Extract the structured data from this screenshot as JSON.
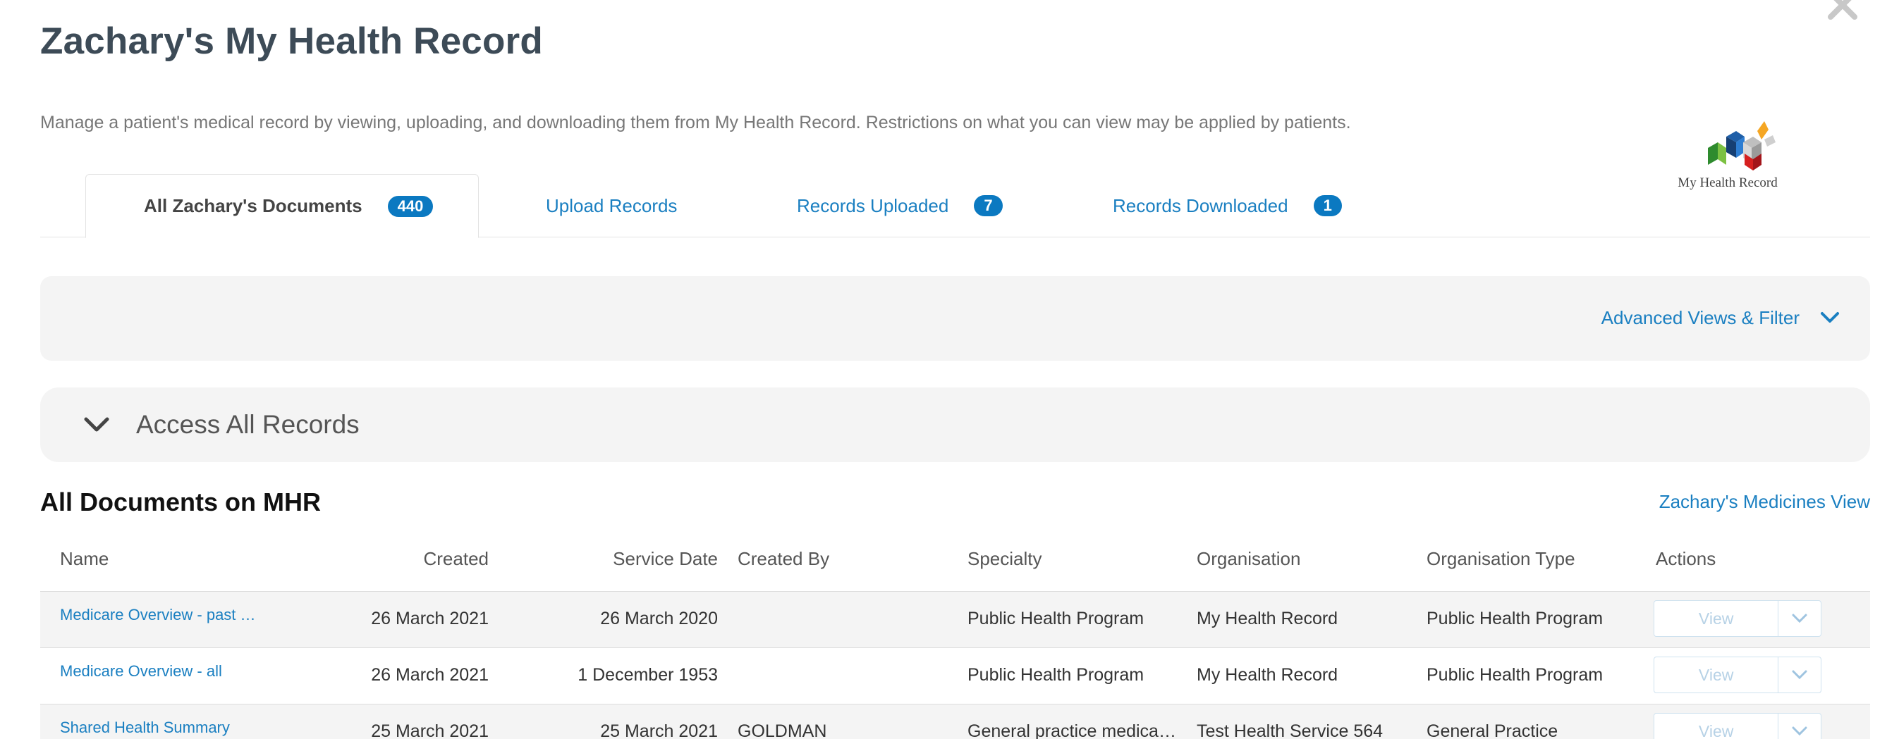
{
  "page": {
    "title": "Zachary's My Health Record",
    "description": "Manage a patient's medical record by viewing, uploading, and downloading them from My Health Record. Restrictions on what you can view may be applied by patients."
  },
  "logo": {
    "text": "My Health Record"
  },
  "tabs": [
    {
      "label": "All Zachary's Documents",
      "badge": "440",
      "active": true
    },
    {
      "label": "Upload Records",
      "badge": null,
      "active": false
    },
    {
      "label": "Records Uploaded",
      "badge": "7",
      "active": false
    },
    {
      "label": "Records Downloaded",
      "badge": "1",
      "active": false
    }
  ],
  "filter": {
    "label": "Advanced Views & Filter"
  },
  "access": {
    "label": "Access All Records"
  },
  "section": {
    "title": "All Documents on MHR",
    "medicines_link": "Zachary's Medicines View"
  },
  "table": {
    "headers": {
      "name": "Name",
      "created": "Created",
      "service_date": "Service Date",
      "created_by": "Created By",
      "specialty": "Specialty",
      "organisation": "Organisation",
      "organisation_type": "Organisation Type",
      "actions": "Actions"
    },
    "action_label": "View",
    "rows": [
      {
        "name": "Medicare Overview - past …",
        "created": "26 March 2021",
        "service_date": "26 March 2020",
        "created_by": "",
        "specialty": "Public Health Program",
        "organisation": "My Health Record",
        "organisation_type": "Public Health Program"
      },
      {
        "name": "Medicare Overview - all",
        "created": "26 March 2021",
        "service_date": "1 December 1953",
        "created_by": "",
        "specialty": "Public Health Program",
        "organisation": "My Health Record",
        "organisation_type": "Public Health Program"
      },
      {
        "name": "Shared Health Summary",
        "created": "25 March 2021",
        "service_date": "25 March 2021",
        "created_by": "GOLDMAN",
        "specialty": "General practice medical …",
        "organisation": "Test Health Service 564",
        "organisation_type": "General Practice"
      }
    ]
  },
  "colors": {
    "accent": "#1a7fc1",
    "badge": "#0b79c1",
    "panel": "#f4f4f4"
  }
}
